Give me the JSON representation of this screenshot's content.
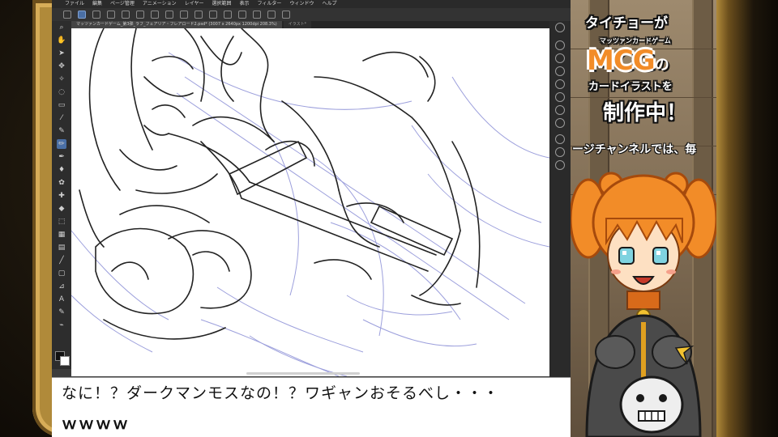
{
  "app": {
    "menu": [
      "ファイル",
      "編集",
      "ページ管理",
      "アニメーション",
      "レイヤー",
      "選択範囲",
      "表示",
      "フィルター",
      "ウィンドウ",
      "ヘルプ"
    ],
    "tabs": [
      "マッツァンカードゲーム_第3弾_ラフ_フェアリア・フレアロード2.psd* (3007 x 2640px 1200dpi 208.3%)",
      "イラスト*"
    ]
  },
  "subtitle": {
    "line1": "なに！？ダークマンモスなの！？ワギャンおそるべし・・・",
    "line2": "ｗｗｗｗ"
  },
  "promo": {
    "title_line1": "タイチョーが",
    "title_mcg": "MCG",
    "title_mcg_suffix": "の",
    "title_sub": "マッツァンカードゲーム",
    "title_line3": "カードイラストを",
    "title_line4": "制作中！",
    "scroll_text": "ージチャンネルでは、毎"
  },
  "colors": {
    "accent_blue": "#4a6fa5",
    "mascot_hair": "#f28c28",
    "bezel_gold": "#b08a3a"
  }
}
